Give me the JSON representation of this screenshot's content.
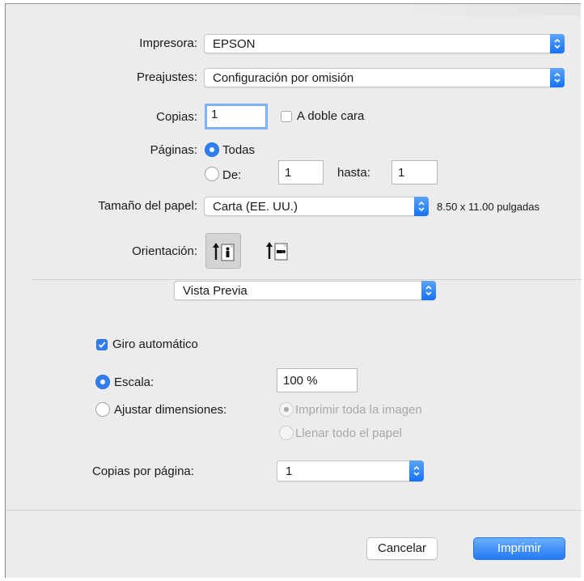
{
  "printer": {
    "label": "Impresora:",
    "value": "EPSON"
  },
  "presets": {
    "label": "Preajustes:",
    "value": "Configuración por omisión"
  },
  "copies": {
    "label": "Copias:",
    "value": "1",
    "two_sided_label": "A doble cara",
    "two_sided_checked": false
  },
  "pages": {
    "label": "Páginas:",
    "all_label": "Todas",
    "from_label": "De:",
    "from_value": "1",
    "to_label": "hasta:",
    "to_value": "1",
    "selected": "all"
  },
  "paper_size": {
    "label": "Tamaño del papel:",
    "value": "Carta (EE. UU.)",
    "dimensions": "8.50 x 11.00 pulgadas"
  },
  "orientation": {
    "label": "Orientación:",
    "selected": "portrait"
  },
  "section_menu": {
    "value": "Vista Previa"
  },
  "preview": {
    "auto_rotate_label": "Giro automático",
    "auto_rotate_checked": true,
    "scale_label": "Escala:",
    "scale_value": "100 %",
    "scale_selected": true,
    "fit_label": "Ajustar dimensiones:",
    "print_entire_label": "Imprimir toda la imagen",
    "fill_paper_label": "Llenar todo el papel"
  },
  "copies_per_page": {
    "label": "Copias por página:",
    "value": "1"
  },
  "buttons": {
    "cancel": "Cancelar",
    "print": "Imprimir"
  },
  "colors": {
    "accent": "#2f7ef3",
    "dialog_bg": "#ececec"
  }
}
